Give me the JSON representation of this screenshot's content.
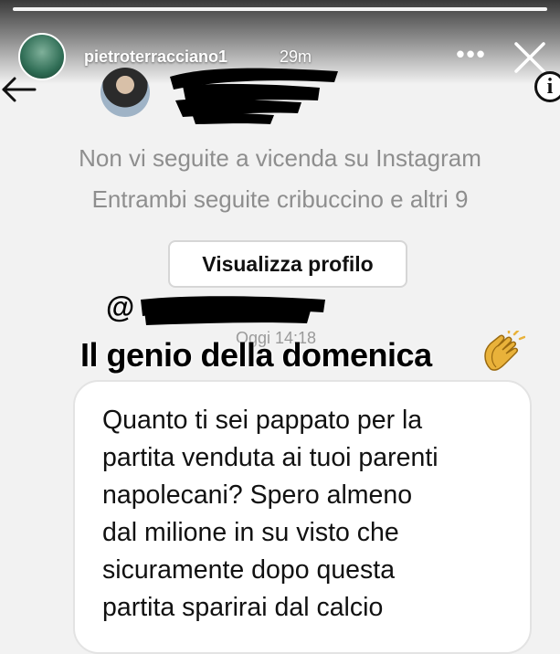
{
  "story": {
    "username": "pietroterracciano1",
    "time_ago": "29m",
    "more_label": "•••"
  },
  "dm": {
    "no_follow_text": "Non vi seguite a vicenda su Instagram",
    "mutual_text": "Entrambi seguite cribuccino e altri 9",
    "view_profile_label": "Visualizza profilo",
    "info_label": "i",
    "date": "Oggi 14:18",
    "message": "Quanto ti sei pappato per la\npartita venduta ai tuoi parenti\nnapolecani? Spero almeno\ndal milione in su visto che\nsicuramente dopo questa\npartita sparirai dal calcio"
  },
  "overlay": {
    "mention_prefix": "@",
    "caption": "Il genio della domenica"
  },
  "colors": {
    "secondary_text": "#8e8e8e",
    "redaction": "#000000",
    "bubble_border": "#e3e3e3"
  }
}
